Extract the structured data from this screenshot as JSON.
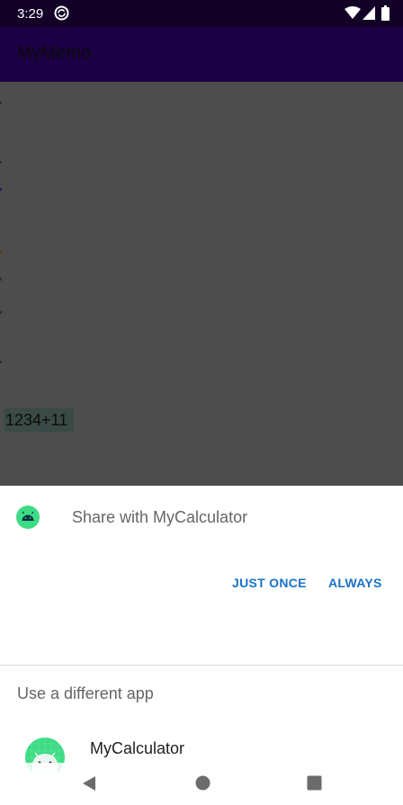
{
  "status_bar": {
    "time": "3:29",
    "icons": [
      "sync-icon",
      "wifi-icon",
      "signal-icon",
      "battery-icon"
    ]
  },
  "app_bar": {
    "title": "MyMemo"
  },
  "memo": {
    "selected_text": "1234+11"
  },
  "share_sheet": {
    "title": "Share with MyCalculator",
    "just_once_label": "JUST ONCE",
    "always_label": "ALWAYS",
    "section_header": "Use a different app",
    "apps": [
      {
        "label": "MyCalculator",
        "icon": "android-app-icon"
      }
    ]
  },
  "nav_bar": {
    "icons": [
      "back-icon",
      "home-icon",
      "recents-icon"
    ]
  },
  "colors": {
    "status_bar_bg": "#120026",
    "app_bar_bg_dimmed": "#1c0045",
    "scrim": "#4d4d4d",
    "accent": "#1a73c7",
    "android_green": "#3ddc84"
  }
}
